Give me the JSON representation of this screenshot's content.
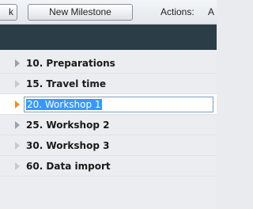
{
  "toolbar": {
    "partial_button_label": "k",
    "new_milestone_label": "New Milestone",
    "actions_label": "Actions:",
    "actions_overflow": "A"
  },
  "milestones": [
    {
      "label": "10. Preparations",
      "arrow": "gray"
    },
    {
      "label": "15. Travel time",
      "arrow": "light"
    },
    {
      "label": "20. Workshop 1",
      "arrow": "orange",
      "editing": true
    },
    {
      "label": "25. Workshop 2",
      "arrow": "gray"
    },
    {
      "label": "30. Workshop 3",
      "arrow": "light"
    },
    {
      "label": "60. Data import",
      "arrow": "light"
    }
  ],
  "colors": {
    "header_band": "#2b3d46",
    "selection": "#3399ff",
    "active_arrow": "#e8902a"
  }
}
